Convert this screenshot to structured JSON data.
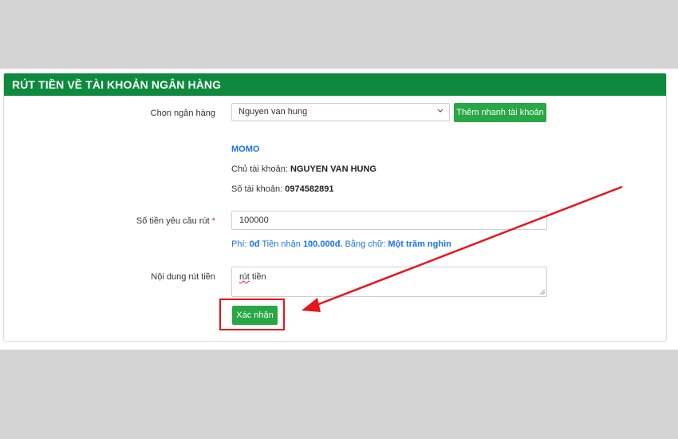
{
  "header": {
    "title": "RÚT TIỀN VỀ TÀI KHOẢN NGÂN HÀNG"
  },
  "bank_select": {
    "label": "Chọn ngân hàng",
    "selected": "Nguyen van hung",
    "quick_add_label": "Thêm nhanh tài khoản"
  },
  "account": {
    "bank_name": "MOMO",
    "holder_label": "Chủ tài khoản:",
    "holder_value": "NGUYEN VAN HUNG",
    "number_label": "Số tài khoản:",
    "number_value": "0974582891"
  },
  "amount": {
    "label": "Số tiền yêu cầu rút",
    "required_mark": "*",
    "value": "100000",
    "fee_label": "Phí:",
    "fee_value": "0đ",
    "receive_label": "Tiền nhận",
    "receive_value": "100.000đ.",
    "words_label": "Bằng chữ:",
    "words_value": "Một trăm nghìn"
  },
  "content": {
    "label": "Nội dung rút tiền",
    "value_part1": "rút",
    "value_part2": " tiền"
  },
  "submit": {
    "label": "Xác nhận"
  },
  "annotation": {
    "color": "#e8141b"
  },
  "icons": {
    "select_chevron": "chevron-down-icon",
    "resize_handle": "resize-grip-icon"
  }
}
